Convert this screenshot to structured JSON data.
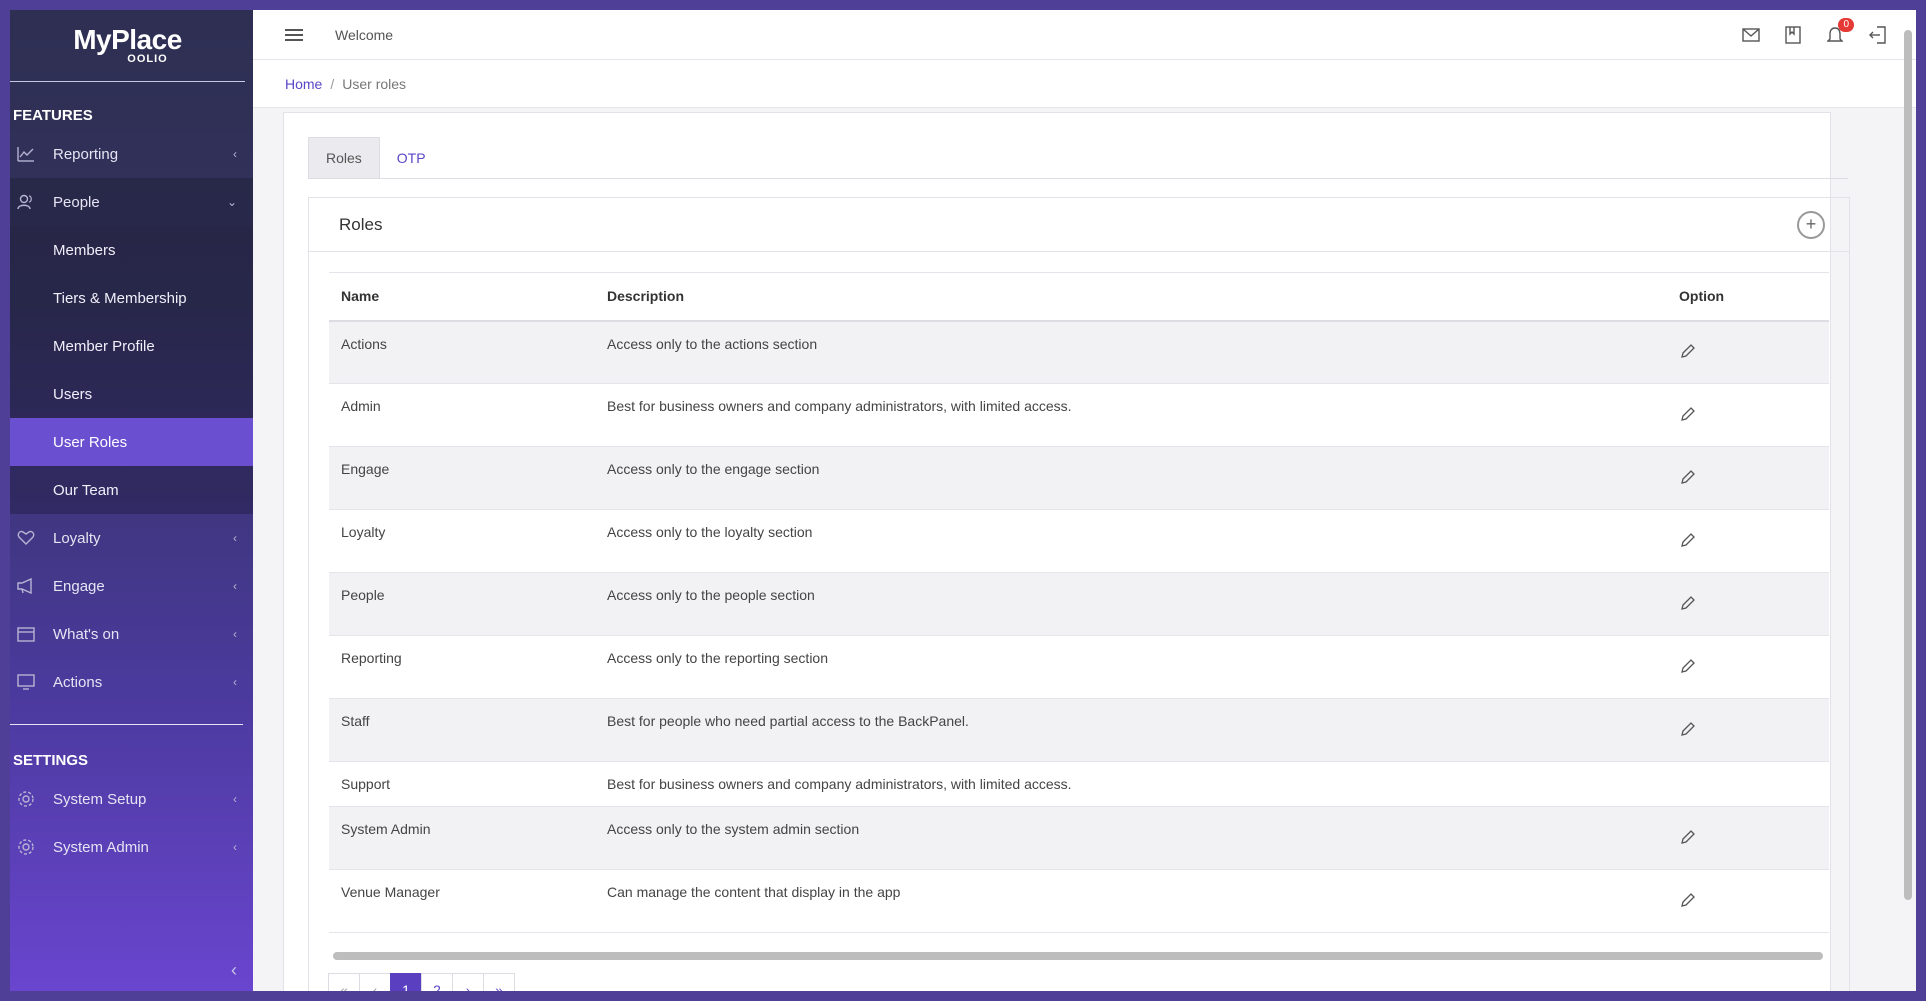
{
  "brand": {
    "name": "MyPlace",
    "sub": "OOLIO"
  },
  "sidebar": {
    "features_title": "FEATURES",
    "settings_title": "SETTINGS",
    "items": [
      {
        "label": "Reporting"
      },
      {
        "label": "People"
      },
      {
        "label": "Loyalty"
      },
      {
        "label": "Engage"
      },
      {
        "label": "What's on"
      },
      {
        "label": "Actions"
      }
    ],
    "people_sub": [
      {
        "label": "Members"
      },
      {
        "label": "Tiers & Membership"
      },
      {
        "label": "Member Profile"
      },
      {
        "label": "Users"
      },
      {
        "label": "User Roles"
      },
      {
        "label": "Our Team"
      }
    ],
    "settings_items": [
      {
        "label": "System Setup"
      },
      {
        "label": "System Admin"
      }
    ]
  },
  "topbar": {
    "welcome": "Welcome",
    "notification_count": "0"
  },
  "breadcrumb": {
    "home": "Home",
    "current": "User roles"
  },
  "tabs": [
    {
      "label": "Roles"
    },
    {
      "label": "OTP"
    }
  ],
  "roles": {
    "title": "Roles",
    "columns": {
      "name": "Name",
      "description": "Description",
      "option": "Option"
    },
    "rows": [
      {
        "name": "Actions",
        "description": "Access only to the actions section"
      },
      {
        "name": "Admin",
        "description": "Best for business owners and company administrators, with limited access."
      },
      {
        "name": "Engage",
        "description": "Access only to the engage section"
      },
      {
        "name": "Loyalty",
        "description": "Access only to the loyalty section"
      },
      {
        "name": "People",
        "description": "Access only to the people section"
      },
      {
        "name": "Reporting",
        "description": "Access only to the reporting section"
      },
      {
        "name": "Staff",
        "description": "Best for people who need partial access to the BackPanel."
      },
      {
        "name": "Support",
        "description": "Best for business owners and company administrators, with limited access."
      },
      {
        "name": "System Admin",
        "description": "Access only to the system admin section"
      },
      {
        "name": "Venue Manager",
        "description": "Can manage the content that display in the app"
      }
    ]
  },
  "pagination": {
    "first": "«",
    "prev": "‹",
    "p1": "1",
    "p2": "2",
    "next": "›",
    "last": "»"
  },
  "colors": {
    "accent": "#5a45c8",
    "active_nav": "#6a4fd0"
  }
}
